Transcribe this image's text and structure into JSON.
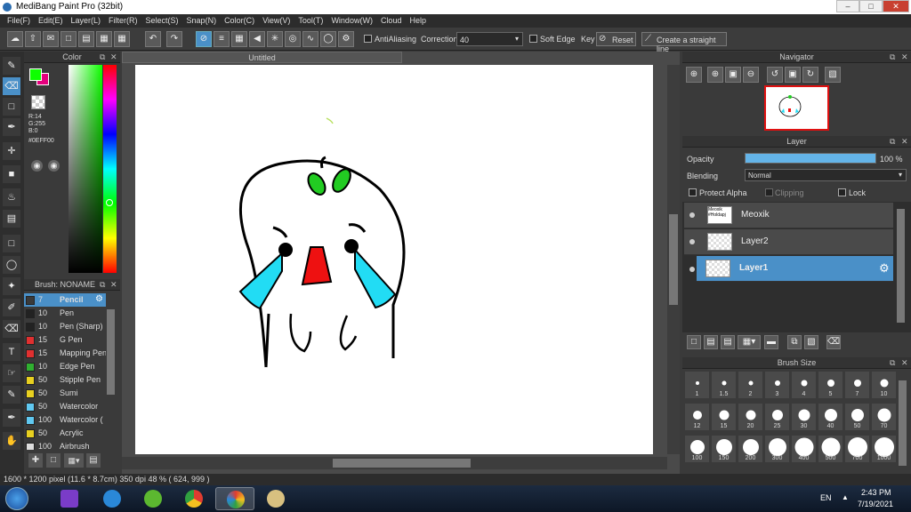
{
  "window": {
    "title": "MediBang Paint Pro (32bit)"
  },
  "menu": [
    "File(F)",
    "Edit(E)",
    "Layer(L)",
    "Filter(R)",
    "Select(S)",
    "Snap(N)",
    "Color(C)",
    "View(V)",
    "Tool(T)",
    "Window(W)",
    "Cloud",
    "Help"
  ],
  "toolbar": {
    "antialiasing": "AntiAliasing",
    "correction_label": "Correction",
    "correction_value": "40",
    "soft_edge": "Soft Edge",
    "key": "Key",
    "reset": "Reset",
    "straight_line": "Create a straight line"
  },
  "color_panel": {
    "title": "Color",
    "r": "R:14",
    "g": "G:255",
    "b": "B:0",
    "hex": "#0EFF00",
    "fg_color": "#0eff00",
    "bg_color": "#e6007e"
  },
  "brush_panel": {
    "title": "Brush: NONAME",
    "items": [
      {
        "size": "7",
        "name": "Pencil",
        "color": "#3a3a3a"
      },
      {
        "size": "10",
        "name": "Pen",
        "color": "#222222"
      },
      {
        "size": "10",
        "name": "Pen (Sharp)",
        "color": "#222222"
      },
      {
        "size": "15",
        "name": "G Pen",
        "color": "#e03030"
      },
      {
        "size": "15",
        "name": "Mapping Pen",
        "color": "#e03030"
      },
      {
        "size": "10",
        "name": "Edge Pen",
        "color": "#30b030"
      },
      {
        "size": "50",
        "name": "Stipple Pen",
        "color": "#e8d020"
      },
      {
        "size": "50",
        "name": "Sumi",
        "color": "#e8d020"
      },
      {
        "size": "50",
        "name": "Watercolor",
        "color": "#60c8f0"
      },
      {
        "size": "100",
        "name": "Watercolor (",
        "color": "#60c8f0"
      },
      {
        "size": "50",
        "name": "Acrylic",
        "color": "#e8d020"
      },
      {
        "size": "100",
        "name": "Airbrush",
        "color": "#dddddd"
      }
    ]
  },
  "canvas": {
    "tab": "Untitled"
  },
  "navigator": {
    "title": "Navigator"
  },
  "layer_panel": {
    "title": "Layer",
    "opacity_label": "Opacity",
    "opacity_value": "100 %",
    "opacity_fraction": 1.0,
    "blending_label": "Blending",
    "blending_value": "Normal",
    "protect_alpha": "Protect Alpha",
    "clipping": "Clipping",
    "lock": "Lock",
    "layers": [
      {
        "name": "Meoxik",
        "thumb": "Meoxik #Holdapj",
        "selected": false
      },
      {
        "name": "Layer2",
        "thumb": "",
        "selected": false
      },
      {
        "name": "Layer1",
        "thumb": "",
        "selected": true
      }
    ]
  },
  "brush_size": {
    "title": "Brush Size",
    "sizes": [
      "1",
      "1.5",
      "2",
      "3",
      "4",
      "5",
      "7",
      "10",
      "12",
      "15",
      "20",
      "25",
      "30",
      "40",
      "50",
      "70",
      "100",
      "150",
      "200",
      "300",
      "400",
      "500",
      "700",
      "1000"
    ]
  },
  "status": "1600 * 1200 pixel   (11.6 * 8.7cm)   350 dpi   48 %   ( 624, 999 )",
  "taskbar": {
    "lang": "EN",
    "time": "2:43 PM",
    "date": "7/19/2021"
  }
}
